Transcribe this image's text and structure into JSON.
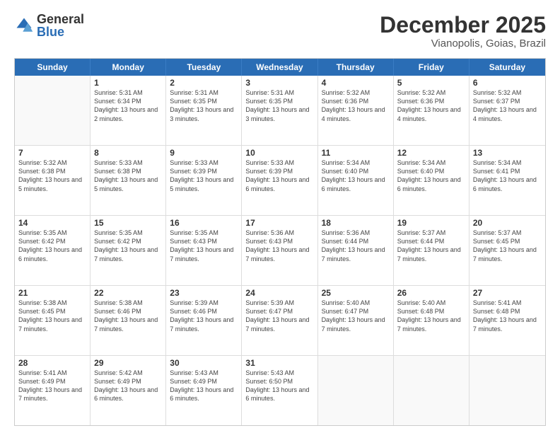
{
  "logo": {
    "general": "General",
    "blue": "Blue"
  },
  "title": "December 2025",
  "subtitle": "Vianopolis, Goias, Brazil",
  "days_of_week": [
    "Sunday",
    "Monday",
    "Tuesday",
    "Wednesday",
    "Thursday",
    "Friday",
    "Saturday"
  ],
  "weeks": [
    [
      {
        "day": "",
        "empty": true
      },
      {
        "day": "1",
        "sunrise": "Sunrise: 5:31 AM",
        "sunset": "Sunset: 6:34 PM",
        "daylight": "Daylight: 13 hours and 2 minutes."
      },
      {
        "day": "2",
        "sunrise": "Sunrise: 5:31 AM",
        "sunset": "Sunset: 6:35 PM",
        "daylight": "Daylight: 13 hours and 3 minutes."
      },
      {
        "day": "3",
        "sunrise": "Sunrise: 5:31 AM",
        "sunset": "Sunset: 6:35 PM",
        "daylight": "Daylight: 13 hours and 3 minutes."
      },
      {
        "day": "4",
        "sunrise": "Sunrise: 5:32 AM",
        "sunset": "Sunset: 6:36 PM",
        "daylight": "Daylight: 13 hours and 4 minutes."
      },
      {
        "day": "5",
        "sunrise": "Sunrise: 5:32 AM",
        "sunset": "Sunset: 6:36 PM",
        "daylight": "Daylight: 13 hours and 4 minutes."
      },
      {
        "day": "6",
        "sunrise": "Sunrise: 5:32 AM",
        "sunset": "Sunset: 6:37 PM",
        "daylight": "Daylight: 13 hours and 4 minutes."
      }
    ],
    [
      {
        "day": "7",
        "sunrise": "Sunrise: 5:32 AM",
        "sunset": "Sunset: 6:38 PM",
        "daylight": "Daylight: 13 hours and 5 minutes."
      },
      {
        "day": "8",
        "sunrise": "Sunrise: 5:33 AM",
        "sunset": "Sunset: 6:38 PM",
        "daylight": "Daylight: 13 hours and 5 minutes."
      },
      {
        "day": "9",
        "sunrise": "Sunrise: 5:33 AM",
        "sunset": "Sunset: 6:39 PM",
        "daylight": "Daylight: 13 hours and 5 minutes."
      },
      {
        "day": "10",
        "sunrise": "Sunrise: 5:33 AM",
        "sunset": "Sunset: 6:39 PM",
        "daylight": "Daylight: 13 hours and 6 minutes."
      },
      {
        "day": "11",
        "sunrise": "Sunrise: 5:34 AM",
        "sunset": "Sunset: 6:40 PM",
        "daylight": "Daylight: 13 hours and 6 minutes."
      },
      {
        "day": "12",
        "sunrise": "Sunrise: 5:34 AM",
        "sunset": "Sunset: 6:40 PM",
        "daylight": "Daylight: 13 hours and 6 minutes."
      },
      {
        "day": "13",
        "sunrise": "Sunrise: 5:34 AM",
        "sunset": "Sunset: 6:41 PM",
        "daylight": "Daylight: 13 hours and 6 minutes."
      }
    ],
    [
      {
        "day": "14",
        "sunrise": "Sunrise: 5:35 AM",
        "sunset": "Sunset: 6:42 PM",
        "daylight": "Daylight: 13 hours and 6 minutes."
      },
      {
        "day": "15",
        "sunrise": "Sunrise: 5:35 AM",
        "sunset": "Sunset: 6:42 PM",
        "daylight": "Daylight: 13 hours and 7 minutes."
      },
      {
        "day": "16",
        "sunrise": "Sunrise: 5:35 AM",
        "sunset": "Sunset: 6:43 PM",
        "daylight": "Daylight: 13 hours and 7 minutes."
      },
      {
        "day": "17",
        "sunrise": "Sunrise: 5:36 AM",
        "sunset": "Sunset: 6:43 PM",
        "daylight": "Daylight: 13 hours and 7 minutes."
      },
      {
        "day": "18",
        "sunrise": "Sunrise: 5:36 AM",
        "sunset": "Sunset: 6:44 PM",
        "daylight": "Daylight: 13 hours and 7 minutes."
      },
      {
        "day": "19",
        "sunrise": "Sunrise: 5:37 AM",
        "sunset": "Sunset: 6:44 PM",
        "daylight": "Daylight: 13 hours and 7 minutes."
      },
      {
        "day": "20",
        "sunrise": "Sunrise: 5:37 AM",
        "sunset": "Sunset: 6:45 PM",
        "daylight": "Daylight: 13 hours and 7 minutes."
      }
    ],
    [
      {
        "day": "21",
        "sunrise": "Sunrise: 5:38 AM",
        "sunset": "Sunset: 6:45 PM",
        "daylight": "Daylight: 13 hours and 7 minutes."
      },
      {
        "day": "22",
        "sunrise": "Sunrise: 5:38 AM",
        "sunset": "Sunset: 6:46 PM",
        "daylight": "Daylight: 13 hours and 7 minutes."
      },
      {
        "day": "23",
        "sunrise": "Sunrise: 5:39 AM",
        "sunset": "Sunset: 6:46 PM",
        "daylight": "Daylight: 13 hours and 7 minutes."
      },
      {
        "day": "24",
        "sunrise": "Sunrise: 5:39 AM",
        "sunset": "Sunset: 6:47 PM",
        "daylight": "Daylight: 13 hours and 7 minutes."
      },
      {
        "day": "25",
        "sunrise": "Sunrise: 5:40 AM",
        "sunset": "Sunset: 6:47 PM",
        "daylight": "Daylight: 13 hours and 7 minutes."
      },
      {
        "day": "26",
        "sunrise": "Sunrise: 5:40 AM",
        "sunset": "Sunset: 6:48 PM",
        "daylight": "Daylight: 13 hours and 7 minutes."
      },
      {
        "day": "27",
        "sunrise": "Sunrise: 5:41 AM",
        "sunset": "Sunset: 6:48 PM",
        "daylight": "Daylight: 13 hours and 7 minutes."
      }
    ],
    [
      {
        "day": "28",
        "sunrise": "Sunrise: 5:41 AM",
        "sunset": "Sunset: 6:49 PM",
        "daylight": "Daylight: 13 hours and 7 minutes."
      },
      {
        "day": "29",
        "sunrise": "Sunrise: 5:42 AM",
        "sunset": "Sunset: 6:49 PM",
        "daylight": "Daylight: 13 hours and 6 minutes."
      },
      {
        "day": "30",
        "sunrise": "Sunrise: 5:43 AM",
        "sunset": "Sunset: 6:49 PM",
        "daylight": "Daylight: 13 hours and 6 minutes."
      },
      {
        "day": "31",
        "sunrise": "Sunrise: 5:43 AM",
        "sunset": "Sunset: 6:50 PM",
        "daylight": "Daylight: 13 hours and 6 minutes."
      },
      {
        "day": "",
        "empty": true
      },
      {
        "day": "",
        "empty": true
      },
      {
        "day": "",
        "empty": true
      }
    ]
  ]
}
